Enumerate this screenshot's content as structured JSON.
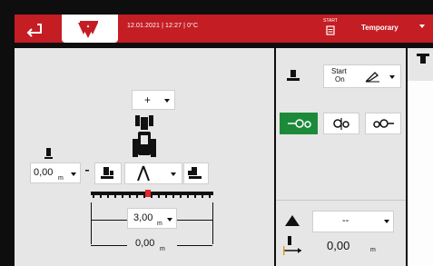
{
  "header": {
    "info": "12.01.2021 | 12:27 | 0°C",
    "start_label": "START",
    "profile": "Temporary"
  },
  "left": {
    "top_select": "+",
    "left_value": "0,00",
    "left_unit": "m",
    "spacing_value": "3,00",
    "spacing_unit": "m",
    "bottom_value": "0,00",
    "bottom_unit": "m"
  },
  "right": {
    "start_line1": "Start",
    "start_line2": "On",
    "select_value": "--",
    "bottom_value": "0,00",
    "bottom_unit": "m"
  },
  "colors": {
    "brand_red": "#c41d24",
    "active_green": "#1d8a3a"
  }
}
